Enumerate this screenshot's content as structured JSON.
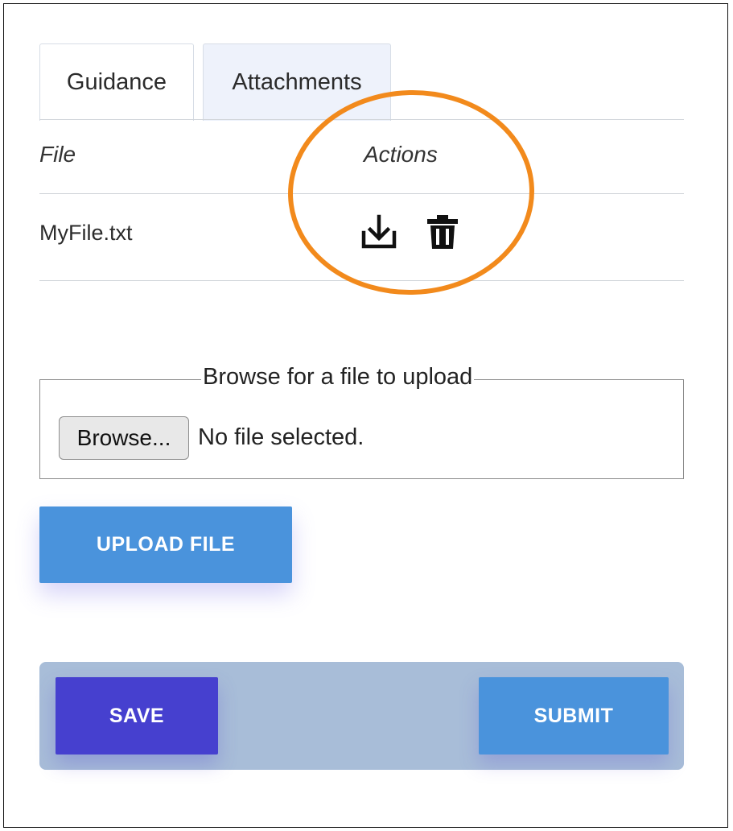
{
  "tabs": [
    {
      "label": "Guidance",
      "active": false
    },
    {
      "label": "Attachments",
      "active": true
    }
  ],
  "table": {
    "columns": [
      "File",
      "Actions"
    ],
    "rows": [
      {
        "file": "MyFile.txt",
        "actions": [
          "download-icon",
          "trash-icon"
        ]
      }
    ]
  },
  "upload": {
    "legend": "Browse for a file to upload",
    "browse_label": "Browse...",
    "status": "No file selected.",
    "upload_button": "UPLOAD FILE"
  },
  "footer": {
    "save_label": "SAVE",
    "submit_label": "SUBMIT"
  },
  "colors": {
    "primary_blue": "#4a93dc",
    "save_purple": "#4640cf",
    "footer_bar": "#a8bdd8",
    "annotation_orange": "#f28a1c",
    "active_tab": "#eef2fb"
  }
}
